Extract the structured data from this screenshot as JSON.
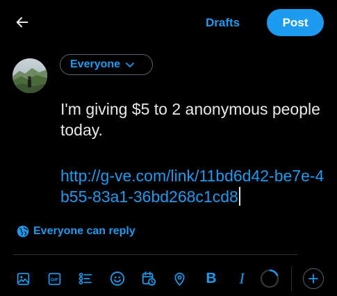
{
  "header": {
    "drafts_label": "Drafts",
    "post_label": "Post"
  },
  "audience": {
    "label": "Everyone"
  },
  "compose": {
    "text": "I'm giving $5 to 2 anonymous people today.",
    "link": "http://g-ve.com/link/11bd6d42-be7e-4b55-83a1-36bd268c1cd8"
  },
  "reply_setting": {
    "label": "Everyone can reply"
  },
  "toolbar": {
    "bold_glyph": "B",
    "italic_glyph": "I",
    "icons": [
      "image-icon",
      "gif-icon",
      "poll-icon",
      "emoji-icon",
      "schedule-icon",
      "location-icon",
      "bold-icon",
      "italic-icon",
      "character-count-ring",
      "add-thread-icon"
    ]
  },
  "colors": {
    "accent": "#1d9bf0",
    "background": "#000000",
    "text": "#e7e9ea",
    "border": "#536471",
    "divider": "#2f3336"
  }
}
